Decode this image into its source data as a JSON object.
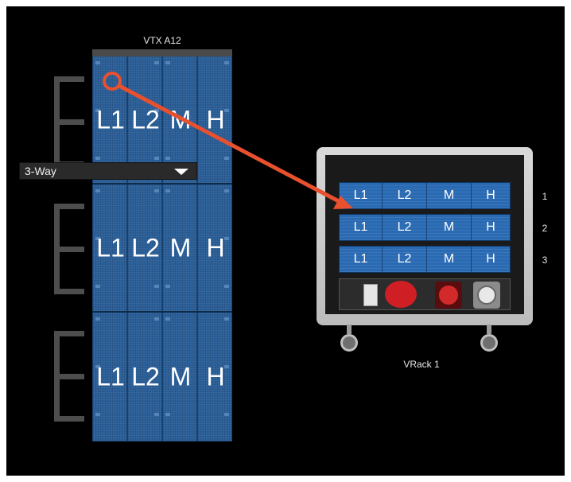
{
  "array": {
    "title": "VTX A12",
    "ways": [
      "L1",
      "L2",
      "M",
      "H"
    ],
    "cabinet_count": 3
  },
  "rack": {
    "dropdown_value": "3-Way",
    "name": "VRack 1",
    "rows": [
      {
        "number": "1",
        "channels": [
          "L1",
          "L2",
          "M",
          "H"
        ]
      },
      {
        "number": "2",
        "channels": [
          "L1",
          "L2",
          "M",
          "H"
        ]
      },
      {
        "number": "3",
        "channels": [
          "L1",
          "L2",
          "M",
          "H"
        ]
      }
    ]
  },
  "colors": {
    "background": "#000000",
    "array_blue": "#2b5f98",
    "amp_blue": "#2a6ab2",
    "connection_arrow": "#e8502e"
  },
  "icons": [
    "connection-arrow-icon",
    "dropdown-caret-icon",
    "breaker-icon",
    "powercon-red-icon",
    "cee-red-icon",
    "powercon-grey-icon",
    "wheel-icon"
  ]
}
